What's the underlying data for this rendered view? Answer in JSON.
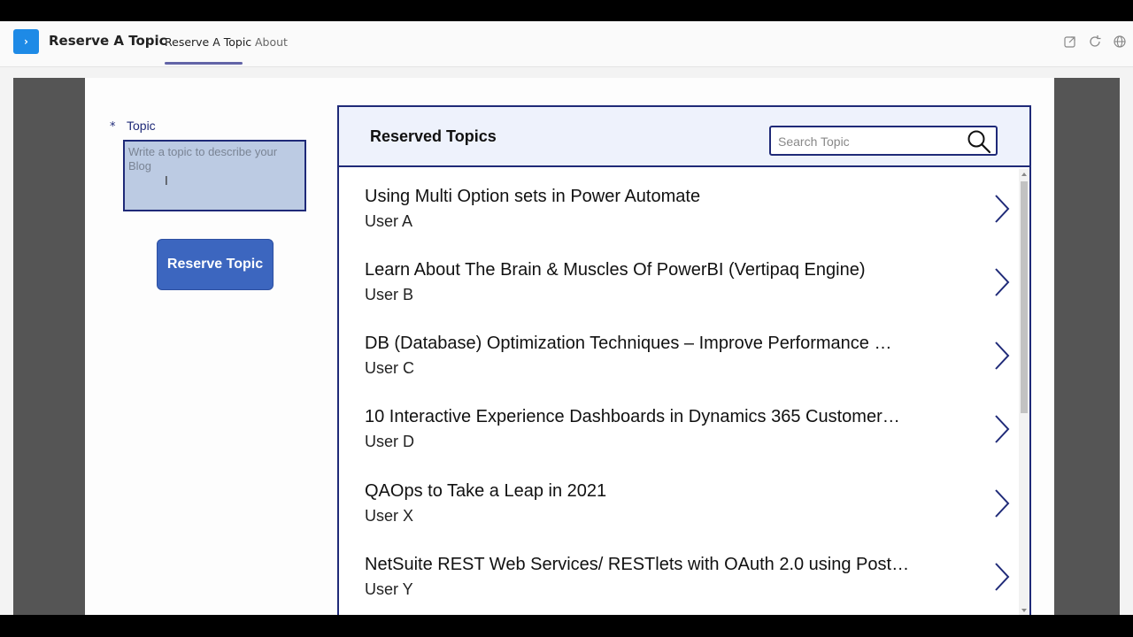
{
  "header": {
    "app_icon_glyph": "›",
    "app_title": "Reserve A Topic",
    "tabs": [
      {
        "label": "Reserve A Topic",
        "active": true
      },
      {
        "label": "About",
        "active": false
      }
    ],
    "icons": [
      "popout-icon",
      "refresh-icon",
      "globe-icon"
    ]
  },
  "form": {
    "required_marker": "*",
    "topic_label": "Topic",
    "topic_placeholder": "Write a topic to describe your Blog",
    "topic_value": "",
    "cursor_glyph": "I",
    "reserve_button_label": "Reserve Topic"
  },
  "list": {
    "title": "Reserved Topics",
    "search_placeholder": "Search Topic",
    "items": [
      {
        "title": "Using Multi Option sets in Power Automate",
        "user": "User A"
      },
      {
        "title": "Learn About The Brain & Muscles Of PowerBI (Vertipaq Engine)",
        "user": "User B"
      },
      {
        "title": "DB (Database) Optimization Techniques – Improve Performance …",
        "user": "User C"
      },
      {
        "title": "10 Interactive Experience Dashboards in Dynamics 365 Customer…",
        "user": "User D"
      },
      {
        "title": "QAOps to Take a Leap in 2021",
        "user": "User X"
      },
      {
        "title": "NetSuite REST Web Services/ RESTlets with OAuth 2.0 using Post…",
        "user": "User Y"
      }
    ]
  },
  "colors": {
    "accent": "#1f2a78",
    "button": "#3c66bf",
    "app_icon": "#1e8ae6",
    "tab_underline": "#6264a7"
  }
}
